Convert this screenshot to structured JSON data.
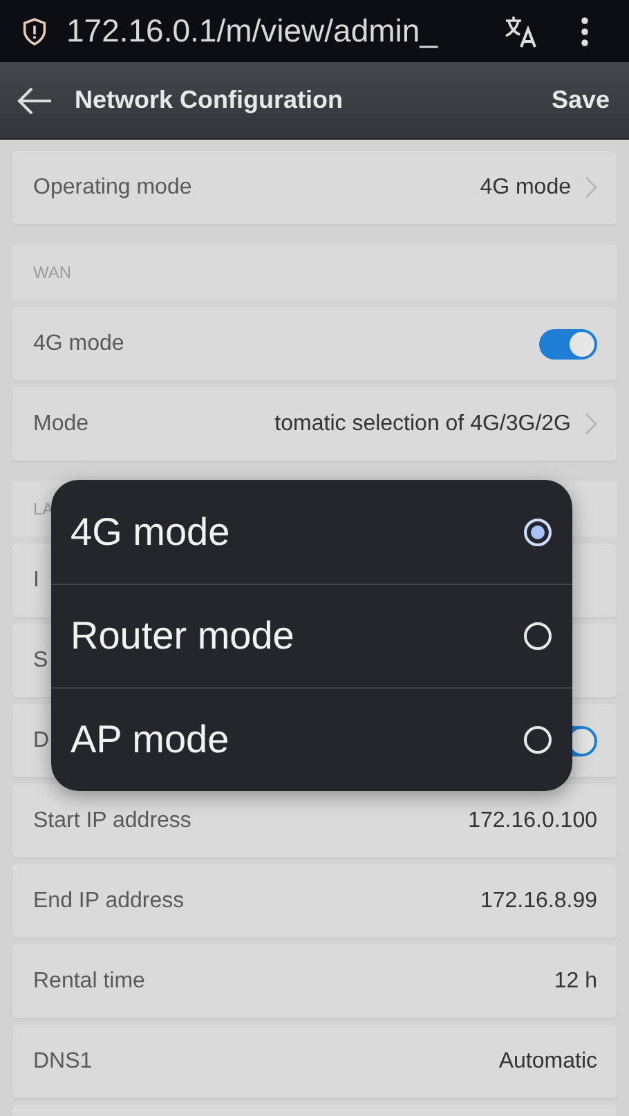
{
  "browser_bar": {
    "url": "172.16.0.1/m/view/admin_"
  },
  "header": {
    "title": "Network Configuration",
    "action": "Save"
  },
  "rows": [
    {
      "kind": "link",
      "label": "Operating mode",
      "value": "4G mode"
    },
    {
      "kind": "section",
      "label": "WAN"
    },
    {
      "kind": "toggle",
      "label": "4G mode",
      "on": true
    },
    {
      "kind": "link",
      "label": "Mode",
      "value": "tomatic selection of 4G/3G/2G"
    },
    {
      "kind": "section",
      "label": "LA"
    },
    {
      "kind": "plain",
      "label": "I"
    },
    {
      "kind": "plain",
      "label": "S"
    },
    {
      "kind": "toggle",
      "label": "D",
      "on": true
    },
    {
      "kind": "plain",
      "label": "Start IP address",
      "value": "172.16.0.100"
    },
    {
      "kind": "plain",
      "label": "End IP address",
      "value": "172.16.8.99"
    },
    {
      "kind": "plain",
      "label": "Rental time",
      "value": "12  h"
    },
    {
      "kind": "plain",
      "label": "DNS1",
      "value": "Automatic"
    },
    {
      "kind": "plain"
    }
  ],
  "popup": {
    "options": [
      {
        "label": "4G mode",
        "selected": true
      },
      {
        "label": "Router mode",
        "selected": false
      },
      {
        "label": "AP mode",
        "selected": false
      }
    ]
  }
}
